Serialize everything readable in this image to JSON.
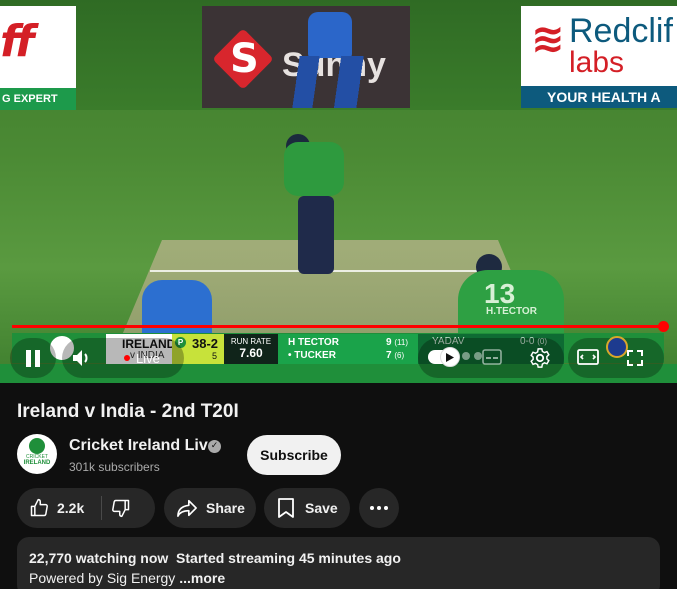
{
  "player": {
    "ads": {
      "left_text": "G EXPERT",
      "middle_text": "Sunny",
      "right_line1": "Redclif",
      "right_line2": "labs",
      "right_strip": "YOUR HEALTH A"
    },
    "scene": {
      "fielder_shirt_number": "13",
      "fielder_shirt_name": "H.TECTOR"
    },
    "scoreboard": {
      "team": "IRELAND",
      "team_sub": "v INDIA",
      "powerplay": "P",
      "score": "38-2",
      "overs": "5",
      "run_rate_label": "RUN RATE",
      "run_rate": "7.60",
      "batters": [
        {
          "name": "H TECTOR",
          "runs": "9",
          "balls": "(11)"
        },
        {
          "name": "• TUCKER",
          "runs": "7",
          "balls": "(6)"
        }
      ],
      "bowler": {
        "name": "YADAV",
        "figures": "0-0",
        "extra": "(0)"
      }
    },
    "controls": {
      "live_label": "Live",
      "progress": 1.0
    },
    "colors": {
      "progress": "#ff0000",
      "scoreboard_green": "#1f8f3a"
    }
  },
  "video": {
    "title": "Ireland v India - 2nd T20I"
  },
  "channel": {
    "avatar_text_top": "CRICKET",
    "avatar_text_bottom": "IRELAND",
    "name": "Cricket Ireland Live",
    "subscribers": "301k subscribers",
    "subscribe_label": "Subscribe"
  },
  "actions": {
    "like_count": "2.2k",
    "share_label": "Share",
    "save_label": "Save"
  },
  "description": {
    "watching": "22,770 watching now",
    "started": "Started streaming 45 minutes ago",
    "powered_by": "Powered by Sig Energy",
    "more_label": "...more"
  }
}
